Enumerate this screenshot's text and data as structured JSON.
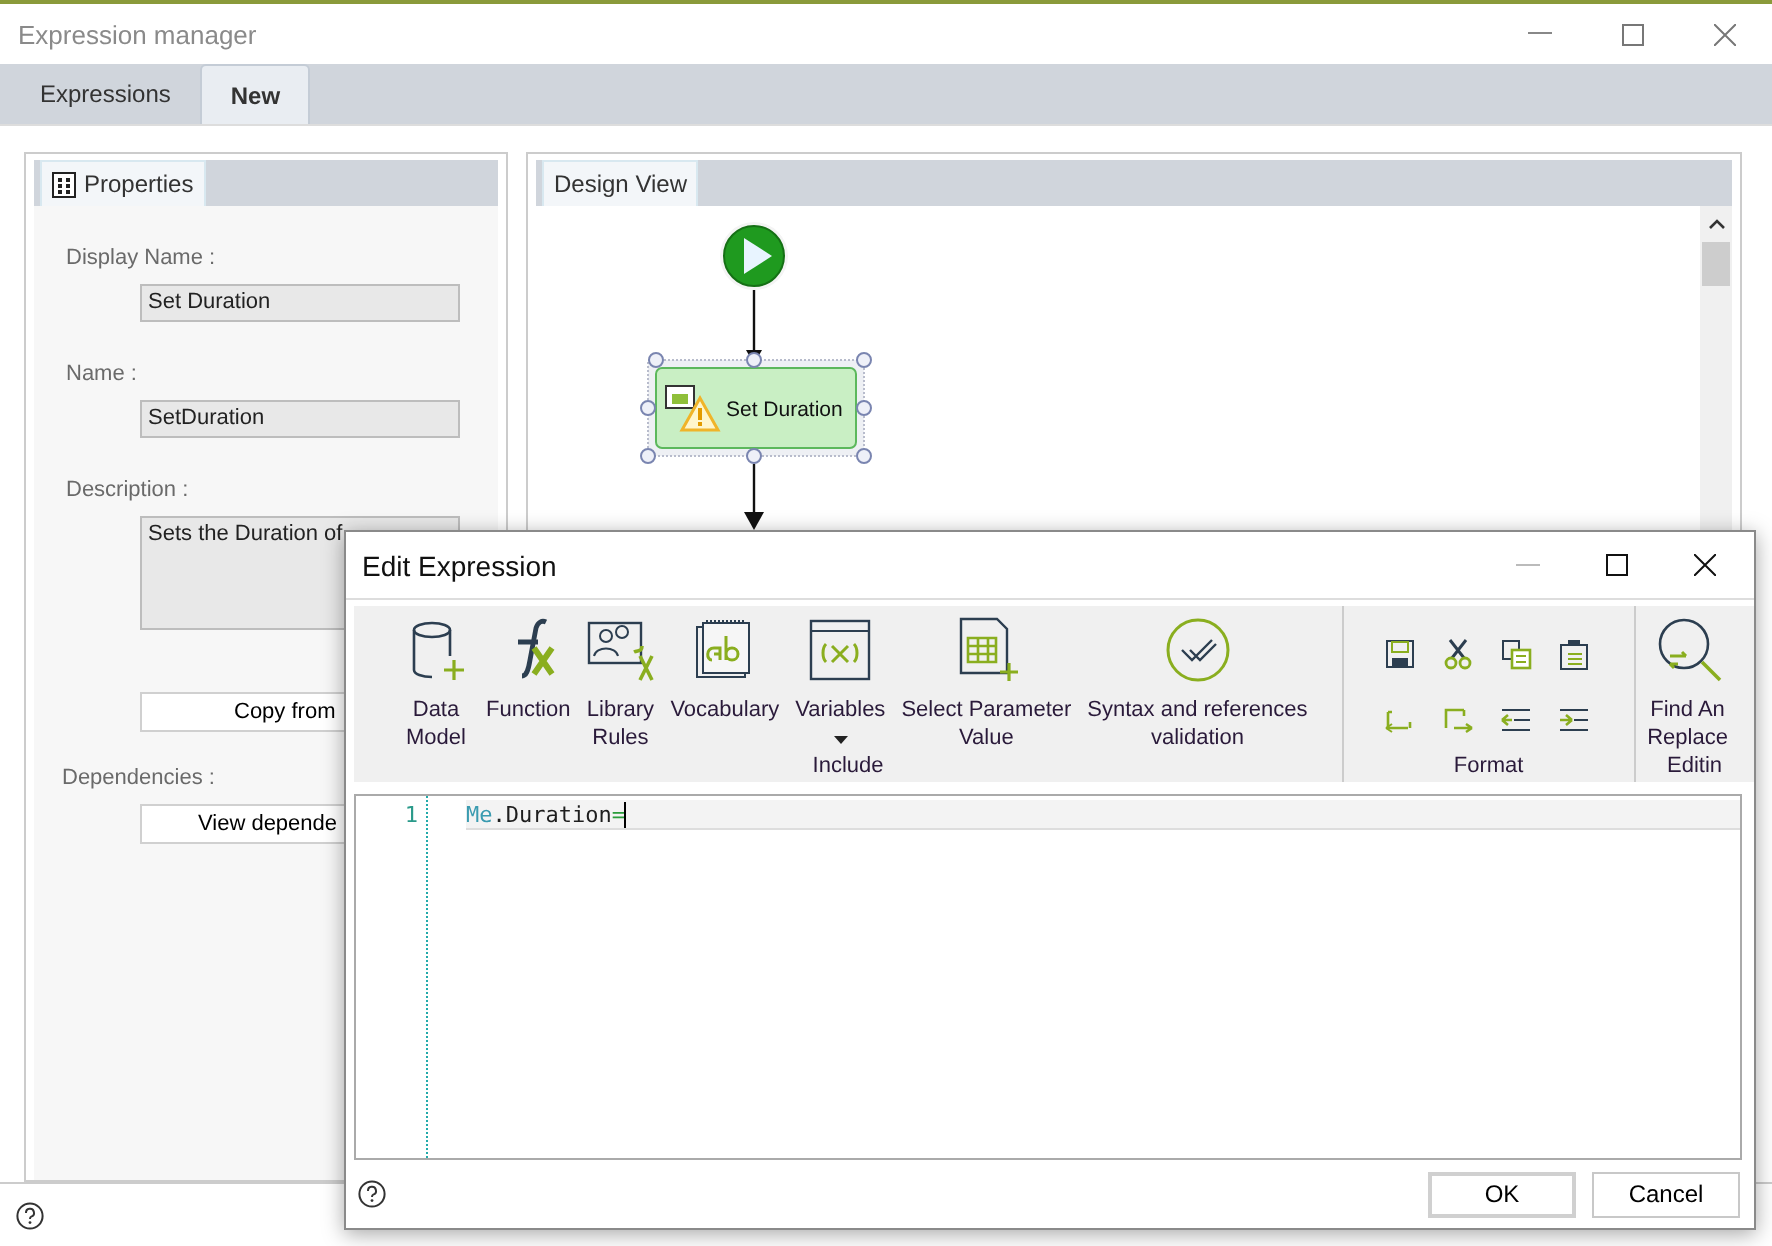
{
  "window": {
    "title": "Expression manager"
  },
  "tabs": [
    {
      "label": "Expressions",
      "selected": false
    },
    {
      "label": "New",
      "selected": true
    }
  ],
  "properties_panel": {
    "tab": "Properties",
    "fields": [
      {
        "label": "Display Name :",
        "value": "Set Duration",
        "kind": "single"
      },
      {
        "label": "Name :",
        "value": "SetDuration",
        "kind": "single"
      },
      {
        "label": "Description :",
        "value": "Sets the Duration of",
        "kind": "multiline"
      }
    ],
    "copy_button": "Copy from",
    "dependencies_label": "Dependencies :",
    "dependencies_button": "View depende"
  },
  "design_view": {
    "tab": "Design View",
    "node": {
      "label": "Set Duration",
      "selected": true,
      "warning": true
    }
  },
  "dialog": {
    "title": "Edit Expression",
    "groups": [
      {
        "label": "Include",
        "tools": [
          {
            "kind": "database",
            "lines": [
              "Data",
              "Model"
            ]
          },
          {
            "kind": "function",
            "lines": [
              "Function"
            ]
          },
          {
            "kind": "library",
            "lines": [
              "Library",
              "Rules"
            ]
          },
          {
            "kind": "vocabulary",
            "lines": [
              "Vocabulary"
            ]
          },
          {
            "kind": "variables",
            "lines": [
              "Variables"
            ],
            "dropdown": true
          },
          {
            "kind": "parameter",
            "lines": [
              "Select Parameter",
              "Value"
            ]
          },
          {
            "kind": "validation",
            "lines": [
              "Syntax and references",
              "validation"
            ]
          }
        ]
      },
      {
        "label": "Format",
        "kind": "format"
      },
      {
        "label": "Editin",
        "tools": [
          {
            "kind": "find",
            "lines": [
              "Find An",
              "Replace"
            ]
          }
        ]
      }
    ],
    "editor": {
      "line_number": "1",
      "code": [
        {
          "text": "Me",
          "kind": "keyword"
        },
        {
          "text": ".Duration",
          "kind": "plain"
        },
        {
          "text": "=",
          "kind": "operator"
        }
      ]
    },
    "buttons": [
      "OK",
      "Cancel"
    ]
  }
}
